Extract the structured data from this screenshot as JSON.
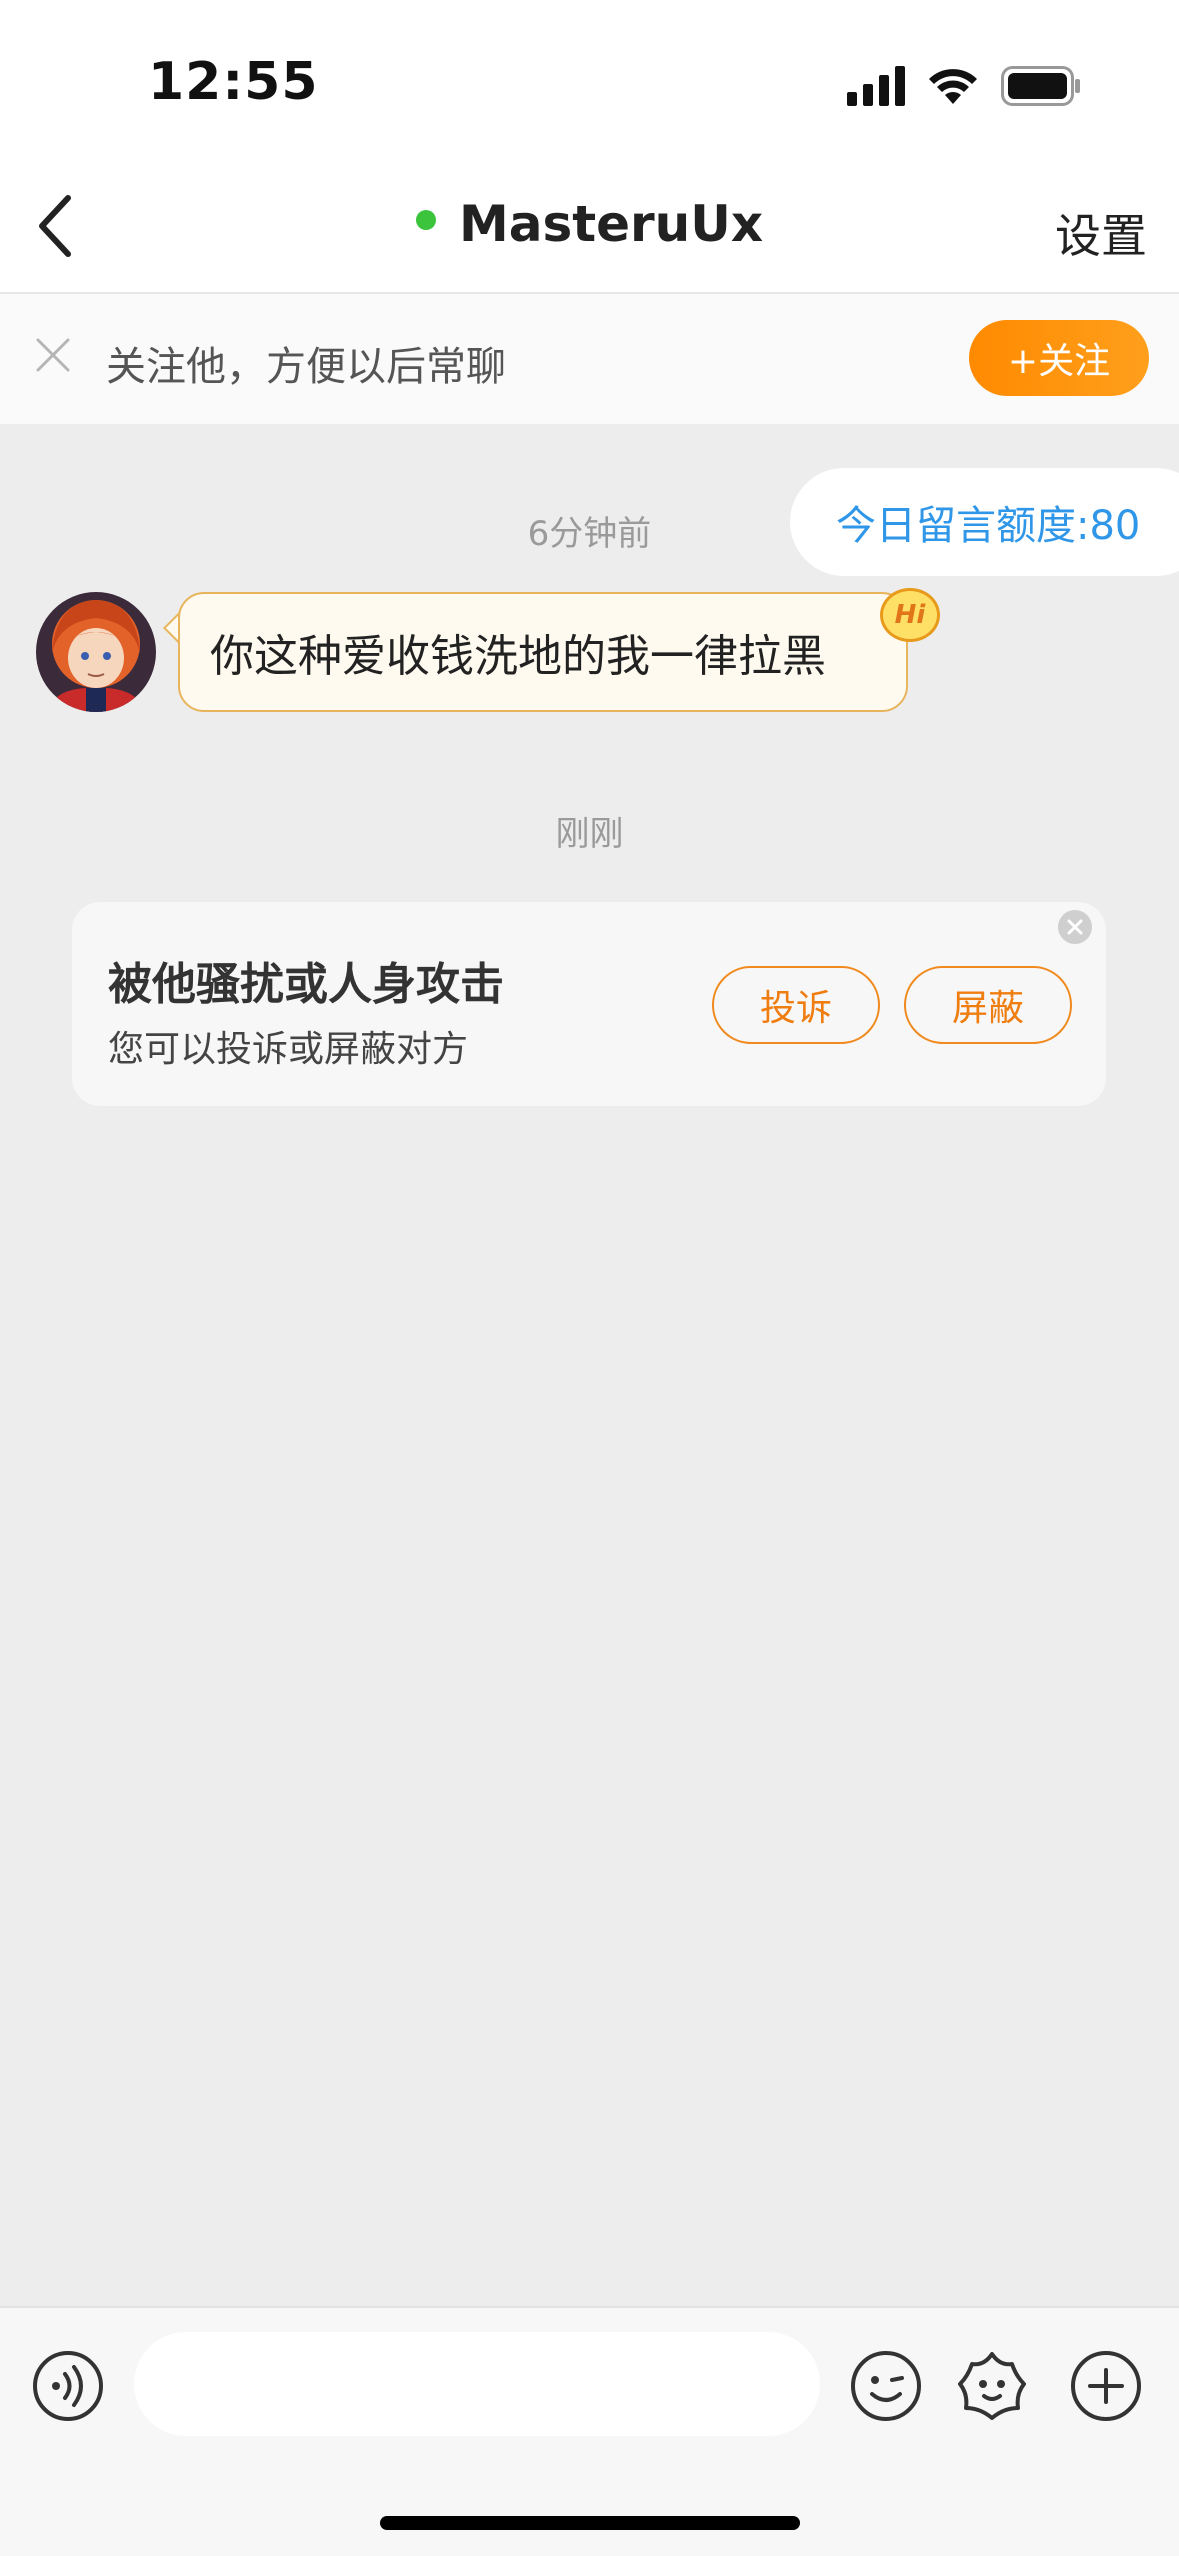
{
  "status_bar": {
    "time": "12:55",
    "icons": [
      "signal-icon",
      "wifi-icon",
      "battery-icon"
    ]
  },
  "nav": {
    "back_icon": "chevron-left-icon",
    "title": "MasteruUx",
    "online_color": "#3cc43c",
    "settings_label": "设置"
  },
  "follow_banner": {
    "text": "关注他，方便以后常聊",
    "button_label": "+关注",
    "accent_color": "#ff8a00"
  },
  "chat": {
    "quota_label": "今日留言额度:80",
    "messages": [
      {
        "time_label": "6分钟前",
        "text": "你这种爱收钱洗地的我一律拉黑",
        "badge": "Hi"
      }
    ],
    "second_time_label": "刚刚"
  },
  "report_card": {
    "title": "被他骚扰或人身攻击",
    "subtitle": "您可以投诉或屏蔽对方",
    "complain_label": "投诉",
    "block_label": "屏蔽",
    "accent_color": "#f08a1e"
  },
  "input_bar": {
    "voice_icon": "voice-icon",
    "input_placeholder": "",
    "emoji_icon": "emoji-icon",
    "sticker_icon": "sticker-icon",
    "add_icon": "plus-circle-icon"
  }
}
